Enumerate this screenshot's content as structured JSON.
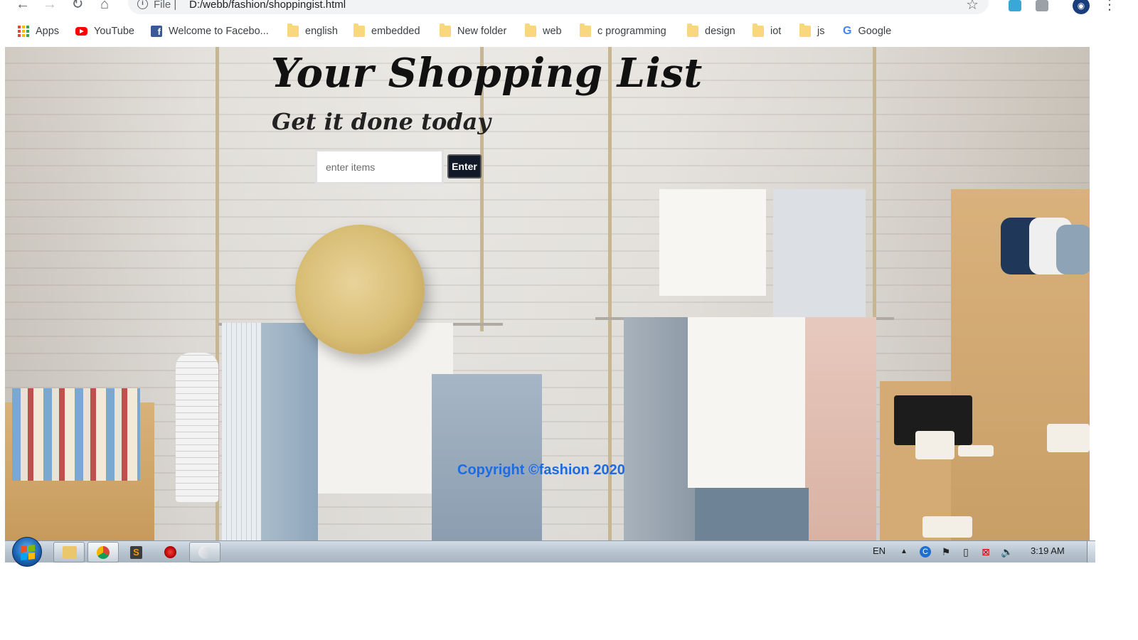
{
  "browser": {
    "url_scheme": "File |",
    "url": "D:/webb/fashion/shoppingist.html",
    "bookmarks": [
      {
        "label": "Apps",
        "icon": "apps-icon"
      },
      {
        "label": "YouTube",
        "icon": "youtube-icon"
      },
      {
        "label": "Welcome to Facebo...",
        "icon": "facebook-icon"
      },
      {
        "label": "english",
        "icon": "folder-icon"
      },
      {
        "label": "embedded",
        "icon": "folder-icon"
      },
      {
        "label": "New folder",
        "icon": "folder-icon"
      },
      {
        "label": "web",
        "icon": "folder-icon"
      },
      {
        "label": "c programming",
        "icon": "folder-icon"
      },
      {
        "label": "design",
        "icon": "folder-icon"
      },
      {
        "label": "iot",
        "icon": "folder-icon"
      },
      {
        "label": "js",
        "icon": "folder-icon"
      },
      {
        "label": "Google",
        "icon": "google-icon"
      }
    ]
  },
  "page": {
    "title": "Your Shopping List",
    "subtitle": "Get it done today",
    "input": {
      "placeholder": "enter items",
      "value": ""
    },
    "enter_label": "Enter",
    "copyright": "Copyright ©fashion 2020"
  },
  "taskbar": {
    "language": "EN",
    "time": "3:19 AM",
    "apps": [
      "file-explorer-icon",
      "chrome-icon",
      "sublime-text-icon",
      "ruby-icon",
      "paint-icon"
    ]
  },
  "colors": {
    "accent_link": "#1e6ce0",
    "button_bg": "#111827",
    "folder": "#f9d77e"
  }
}
